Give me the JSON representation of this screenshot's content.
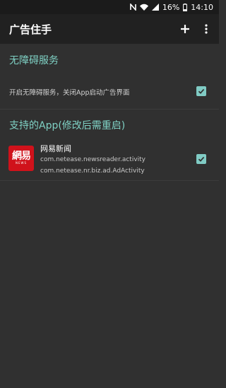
{
  "status_bar": {
    "battery_percent": "16%",
    "time": "14:10",
    "icons": [
      "nfc-icon",
      "signal-icon",
      "wifi-icon",
      "battery-icon"
    ]
  },
  "app_bar": {
    "title": "广告住手",
    "add_icon": "plus-icon",
    "more_icon": "more-vertical-icon"
  },
  "accessibility": {
    "header": "无障碍服务",
    "setting_label": "开启无障碍服务，关闭App启动广告界面",
    "checked": true
  },
  "supported_apps": {
    "header": "支持的App(修改后需重启)",
    "apps": [
      {
        "name": "网易新闻",
        "icon_text": "網易",
        "icon_subtext": "NEWS",
        "icon_color": "#d0121b",
        "activities": [
          "com.netease.newsreader.activity",
          "com.netease.nr.biz.ad.AdActivity"
        ],
        "checked": true
      }
    ]
  },
  "colors": {
    "accent": "#80cbc4",
    "header_text": "#7fd1c4",
    "app_bar": "#212121",
    "background": "#303030"
  }
}
